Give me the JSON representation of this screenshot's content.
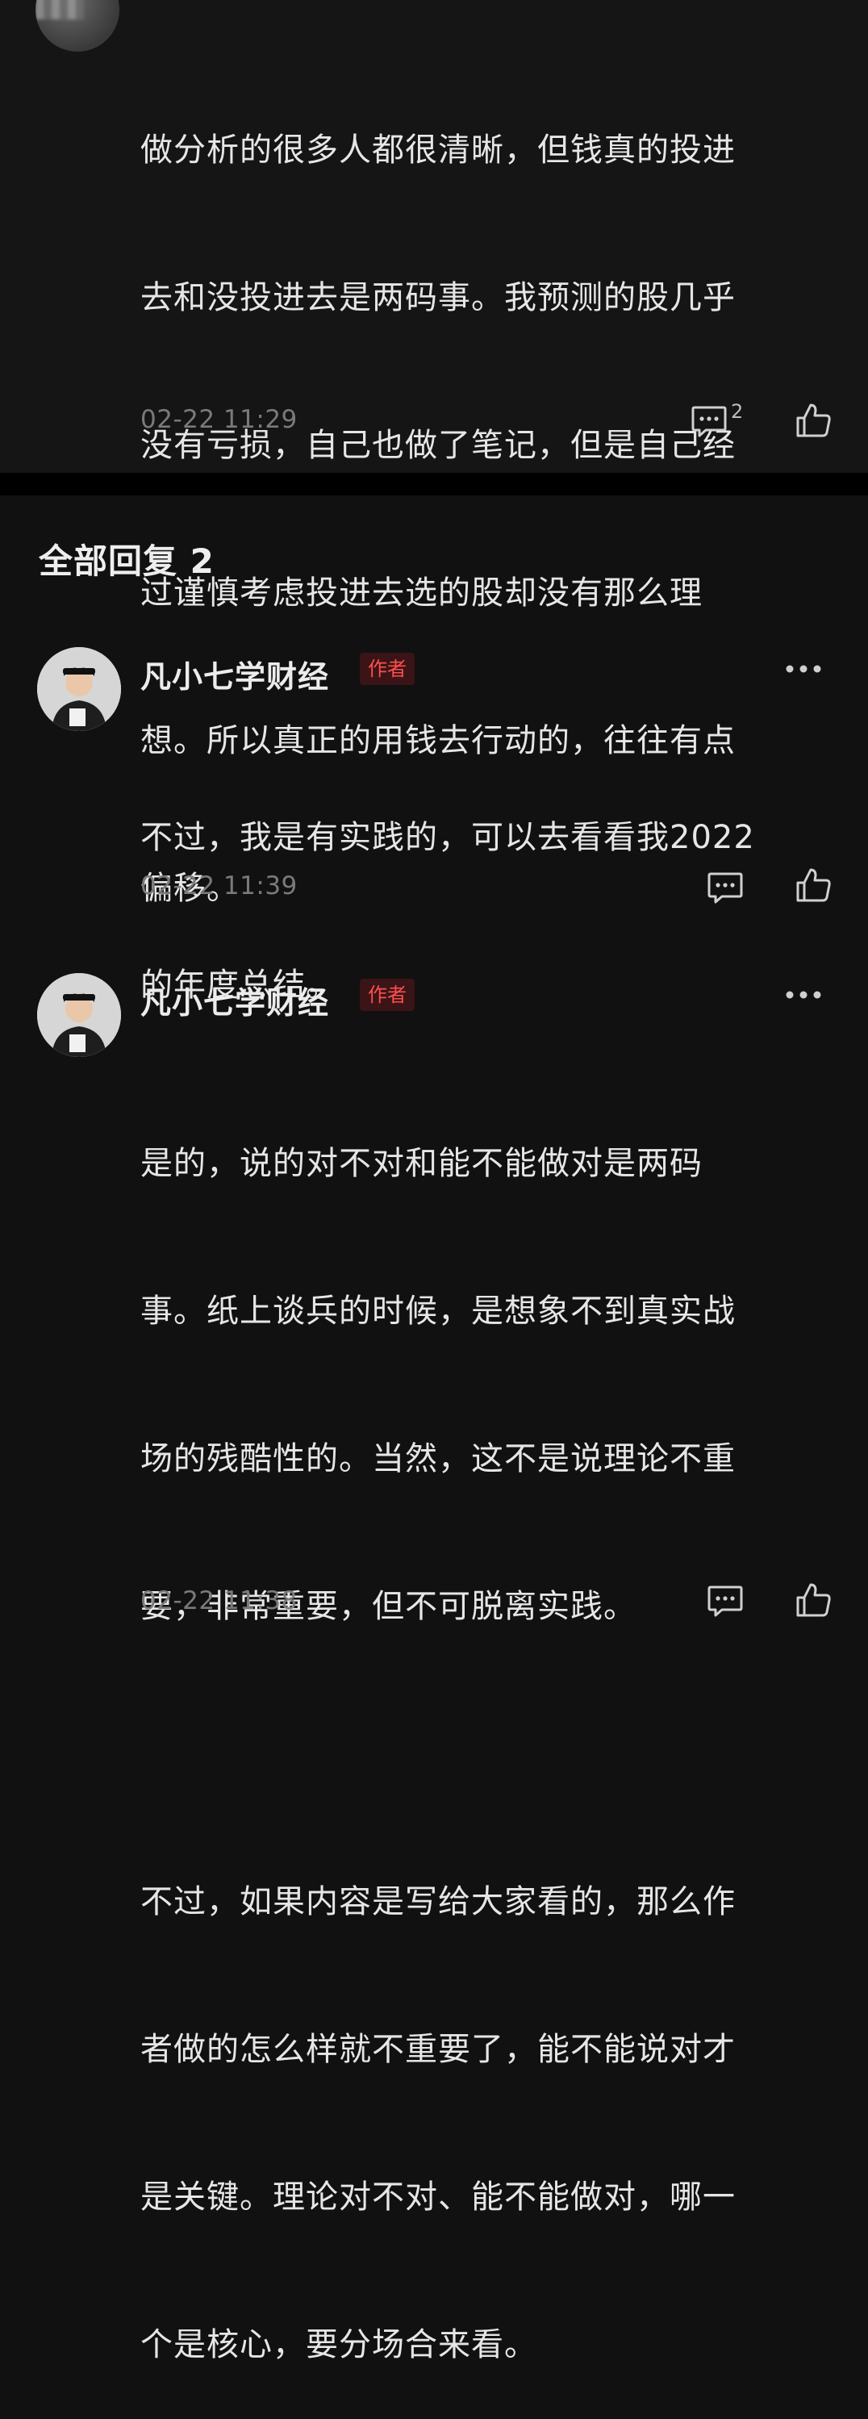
{
  "top_comment": {
    "text": "做分析的很多人都很清晰，但钱真的投进去和没投进去是两码事。我预测的股几乎没有亏损，自己也做了笔记，但是自己经过谨慎考虑投进去选的股却没有那么理想。所以真正的用钱去行动的，往往有点偏移。",
    "lines": [
      "做分析的很多人都很清晰，但钱真的投进",
      "去和没投进去是两码事。我预测的股几乎",
      "没有亏损，自己也做了笔记，但是自己经",
      "过谨慎考虑投进去选的股却没有那么理",
      "想。所以真正的用钱去行动的，往往有点",
      "偏移。"
    ],
    "timestamp": "02-22 11:29",
    "reply_count": "2",
    "icons": {
      "reply": "comment-icon",
      "like": "thumbs-up-icon"
    }
  },
  "replies_section": {
    "title": "全部回复 2"
  },
  "replies": [
    {
      "username": "凡小七学财经",
      "badge": "作者",
      "lines": [
        "不过，我是有实践的，可以去看看我2022",
        "的年度总结。"
      ],
      "timestamp": "02-22 11:39"
    },
    {
      "username": "凡小七学财经",
      "badge": "作者",
      "lines": [
        "是的，说的对不对和能不能做对是两码",
        "事。纸上谈兵的时候，是想象不到真实战",
        "场的残酷性的。当然，这不是说理论不重",
        "要，非常重要，但不可脱离实践。",
        "",
        "不过，如果内容是写给大家看的，那么作",
        "者做的怎么样就不重要了，能不能说对才",
        "是关键。理论对不对、能不能做对，哪一",
        "个是核心，要分场合来看。"
      ],
      "timestamp": "02-22 11:38"
    }
  ],
  "colors": {
    "background": "#111111",
    "text": "#e6e6e6",
    "timestamp": "#7a7a7a",
    "badge_text": "#ff4e4e",
    "badge_bg": "#3a1416"
  }
}
